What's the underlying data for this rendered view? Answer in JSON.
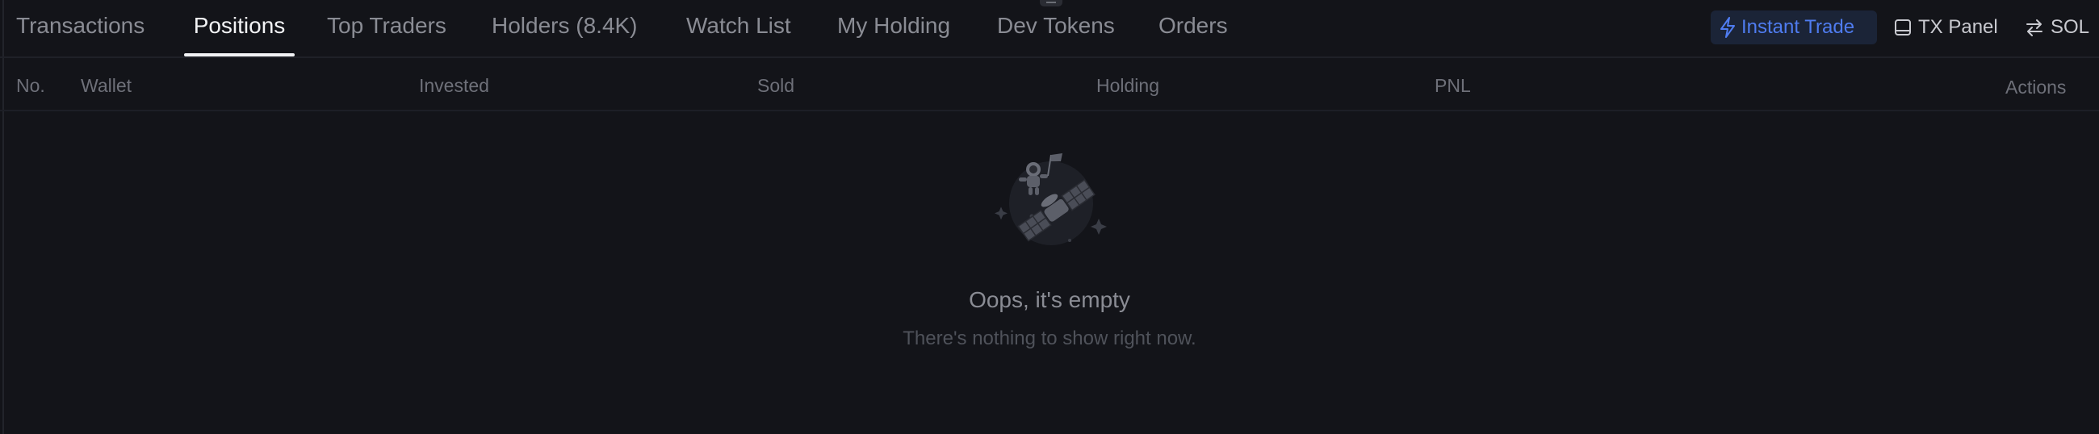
{
  "tabs": [
    {
      "label": "Transactions",
      "active": false
    },
    {
      "label": "Positions",
      "active": true
    },
    {
      "label": "Top Traders",
      "active": false
    },
    {
      "label": "Holders (8.4K)",
      "active": false
    },
    {
      "label": "Watch List",
      "active": false
    },
    {
      "label": "My Holding",
      "active": false
    },
    {
      "label": "Dev Tokens",
      "active": false
    },
    {
      "label": "Orders",
      "active": false
    }
  ],
  "toolbar": {
    "instant_trade": "Instant Trade",
    "tx_panel": "TX Panel",
    "sol": "SOL"
  },
  "table": {
    "columns": [
      "No.",
      "Wallet",
      "Invested",
      "Sold",
      "Holding",
      "PNL",
      "Actions"
    ]
  },
  "empty_state": {
    "title": "Oops, it's empty",
    "subtitle": "There's nothing to show right now."
  },
  "colors": {
    "background": "#131419",
    "accent": "#4f7cf0",
    "active_tab": "#f2f3f5"
  }
}
